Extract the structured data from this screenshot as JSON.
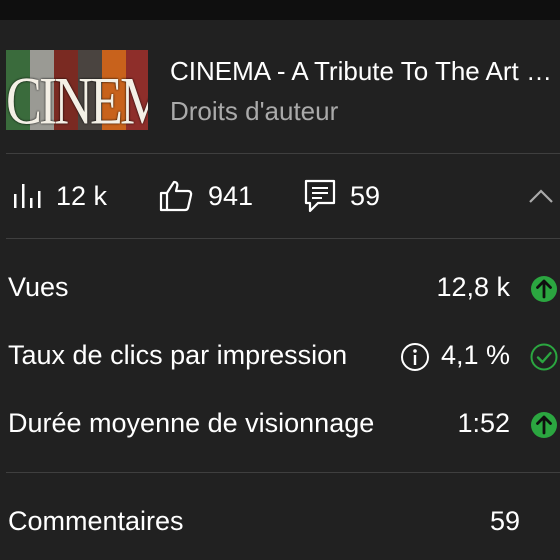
{
  "video": {
    "thumbnail_text": "CINEMA",
    "title": "CINEMA - A Tribute To The Art of Film",
    "subtitle": "Droits d'auteur"
  },
  "stats": {
    "views": "12 k",
    "likes": "941",
    "comments": "59"
  },
  "metrics": [
    {
      "label": "Vues",
      "value": "12,8 k",
      "status": "up-arrow-icon"
    },
    {
      "label": "Taux de clics par impression",
      "value": "4,1 %",
      "status": "check-circle-icon"
    },
    {
      "label": "Durée moyenne de visionnage",
      "value": "1:52",
      "status": "up-arrow-icon"
    }
  ],
  "comments_section": {
    "label": "Commentaires",
    "count": "59"
  },
  "colors": {
    "background": "#212121",
    "divider": "#3f3f3f",
    "secondary_text": "#aaaaaa",
    "positive": "#2ba640"
  }
}
